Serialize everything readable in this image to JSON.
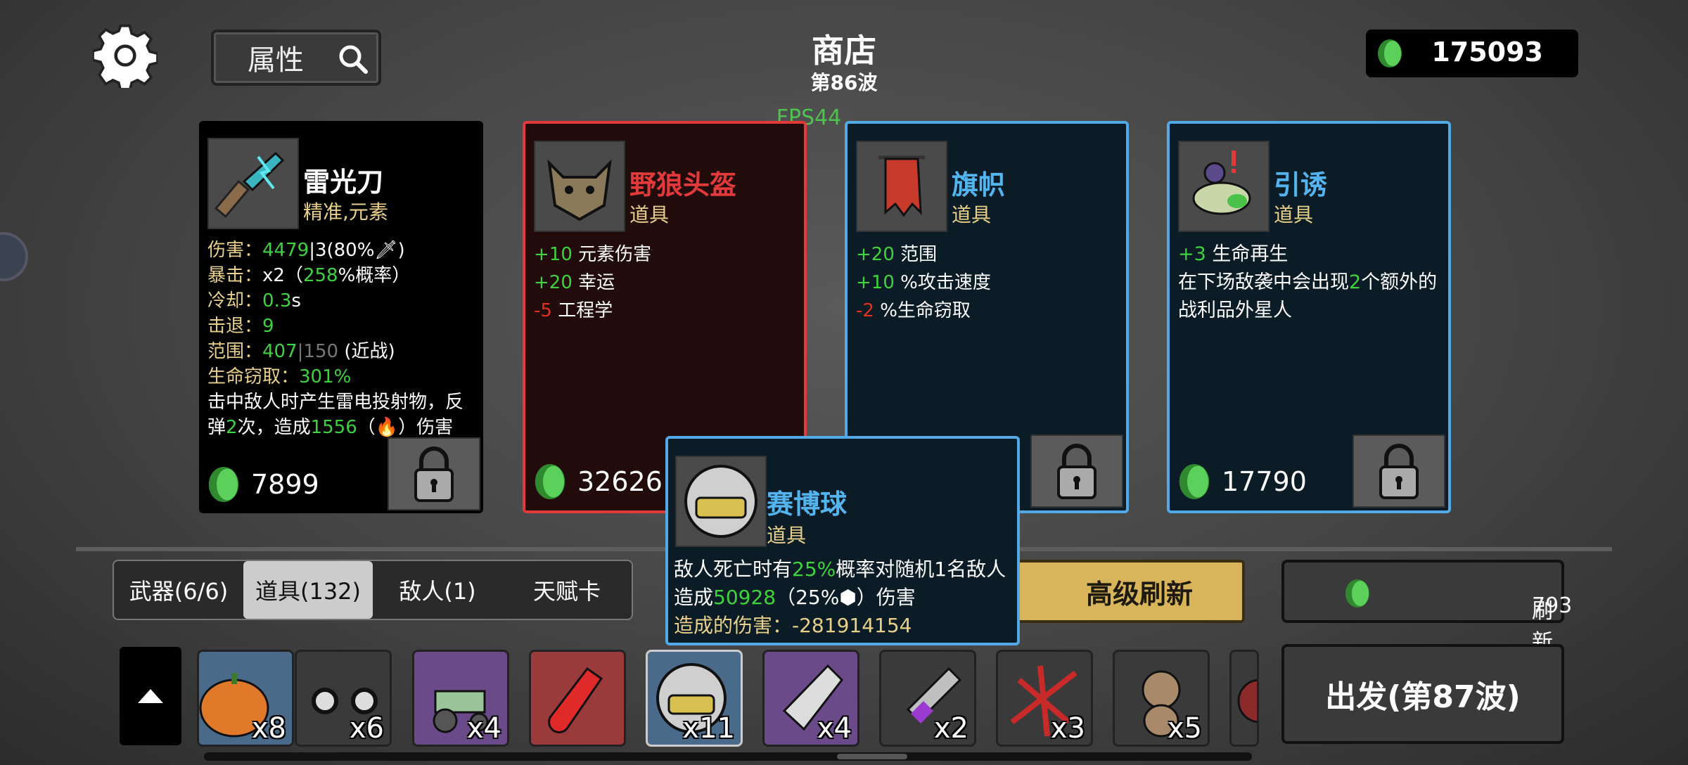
{
  "header": {
    "title": "商店",
    "wave": "第86波",
    "fps": "FPS44",
    "currency": "175093",
    "search_label": "属性"
  },
  "shop_cards": [
    {
      "name": "雷光刀",
      "type": "精准,元素",
      "price": "7899",
      "stats": [
        {
          "label": "伤害：",
          "value": "4479",
          "extra": "|3(80%",
          "extra2": ")"
        },
        {
          "label": "暴击：",
          "value": "x2（",
          "value2": "258",
          "extra": "%概率）"
        },
        {
          "label": "冷却：",
          "value": "0.3",
          "extra": "s"
        },
        {
          "label": "击退：",
          "value": "9"
        },
        {
          "label": "范围：",
          "value": "407",
          "extra": "|150",
          "extra2": "(近战)"
        },
        {
          "label": "生命窃取：",
          "value": "301%"
        }
      ],
      "desc": [
        "击中敌人时产生雷电投射物，反弹",
        "2",
        "次，造成",
        "1556",
        "（",
        "）伤害"
      ]
    },
    {
      "name": "野狼头盔",
      "type": "道具",
      "price": "32626",
      "effects": [
        {
          "value": "+10",
          "text": "元素伤害"
        },
        {
          "value": "+20",
          "text": "幸运"
        },
        {
          "value": "-5",
          "text": "工程学"
        }
      ]
    },
    {
      "name": "旗帜",
      "type": "道具",
      "price": "",
      "effects": [
        {
          "value": "+20",
          "text": "范围"
        },
        {
          "value": "+10",
          "text": "%攻击速度"
        },
        {
          "value": "-2",
          "text": "%生命窃取"
        }
      ]
    },
    {
      "name": "引诱",
      "type": "道具",
      "price": "17790",
      "effects": [
        {
          "value": "+3",
          "text": "生命再生"
        }
      ],
      "desc": [
        "在下场敌袭中会出现",
        "2",
        "个额外的战利品外星人"
      ]
    }
  ],
  "tooltip": {
    "name": "赛博球",
    "type": "道具",
    "line1a": "敌人死亡时有",
    "line1b": "25%",
    "line1c": "概率对随机1名敌人造成",
    "line1d": "50928",
    "line1e": "（25%",
    "line1f": "）伤害",
    "line2a": "造成的伤害：",
    "line2b": "-281914154"
  },
  "tabs": [
    {
      "label": "武器(6/6)",
      "active": false
    },
    {
      "label": "道具(132)",
      "active": true
    },
    {
      "label": "敌人(1)",
      "active": false
    },
    {
      "label": "天赋卡",
      "active": false
    }
  ],
  "buttons": {
    "advanced_refresh": "高级刷新",
    "refresh_cost": "793",
    "refresh_label": "刷新",
    "go": "出发(第87波)"
  },
  "inventory": [
    {
      "icon": "pumpkin-icon",
      "count": "x8",
      "bg": "#4a6a8a"
    },
    {
      "icon": "goggles-icon",
      "count": "x6",
      "bg": "#3a3a3a"
    },
    {
      "icon": "tractor-icon",
      "count": "x4",
      "bg": "#6b4a8a"
    },
    {
      "icon": "potion-icon",
      "count": "",
      "bg": "#9a3a3a"
    },
    {
      "icon": "cyber-ball-icon",
      "count": "x11",
      "bg": "#4a6a8a"
    },
    {
      "icon": "bullet-icon",
      "count": "x4",
      "bg": "#6b4a8a"
    },
    {
      "icon": "syringe-icon",
      "count": "x2",
      "bg": "#3a3a3a"
    },
    {
      "icon": "red-claw-icon",
      "count": "x3",
      "bg": "#3a3a3a"
    },
    {
      "icon": "monkey-icon",
      "count": "x5",
      "bg": "#3a3a3a"
    },
    {
      "icon": "spider-icon",
      "count": "",
      "bg": "#3a3a3a"
    }
  ],
  "colors": {
    "positive": "#3fd23f",
    "negative": "#e0301e",
    "legendary_border": "#e23a3a",
    "rare_border": "#53a9e6",
    "type_text": "#e8d08a"
  }
}
